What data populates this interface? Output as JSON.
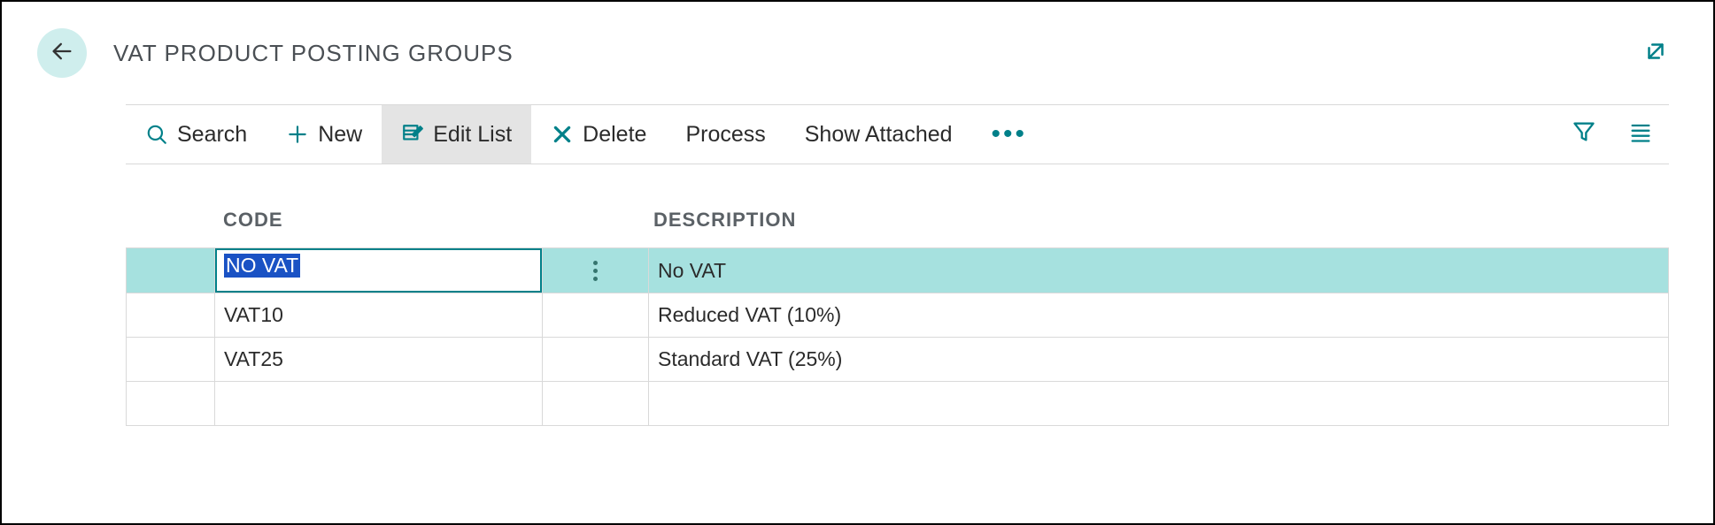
{
  "header": {
    "title": "VAT PRODUCT POSTING GROUPS"
  },
  "toolbar": {
    "search": "Search",
    "new": "New",
    "edit_list": "Edit List",
    "delete": "Delete",
    "process": "Process",
    "show_attached": "Show Attached"
  },
  "grid": {
    "columns": {
      "code": "CODE",
      "description": "DESCRIPTION"
    },
    "rows": [
      {
        "code": "NO VAT",
        "description": "No VAT",
        "selected": true
      },
      {
        "code": "VAT10",
        "description": "Reduced VAT (10%)",
        "selected": false
      },
      {
        "code": "VAT25",
        "description": "Standard VAT (25%)",
        "selected": false
      },
      {
        "code": "",
        "description": "",
        "selected": false
      }
    ]
  }
}
